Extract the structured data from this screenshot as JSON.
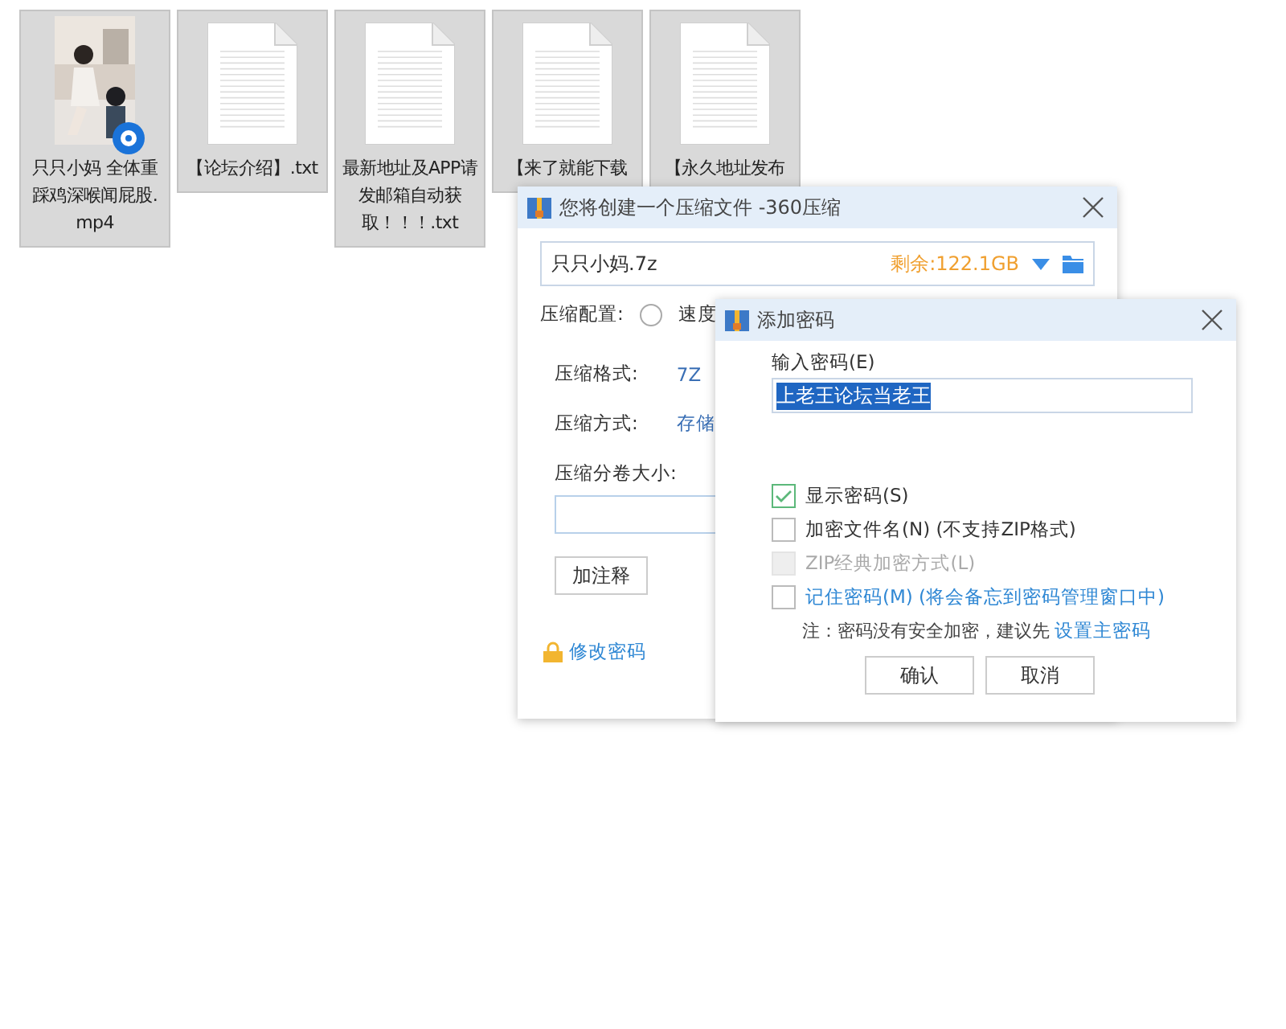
{
  "files": [
    {
      "name": "只只小妈 全体重踩鸡深喉闻屁股.mp4",
      "kind": "video"
    },
    {
      "name": "【论坛介绍】.txt",
      "kind": "text"
    },
    {
      "name": "最新地址及APP请发邮箱自动获取！！！.txt",
      "kind": "text"
    },
    {
      "name": "【来了就能下载",
      "kind": "text"
    },
    {
      "name": "【永久地址发布",
      "kind": "text"
    }
  ],
  "compress_dialog": {
    "title": "您将创建一个压缩文件 -360压缩",
    "filename": "只只小妈.7z",
    "free_space": "剩余:122.1GB",
    "config_label": "压缩配置:",
    "config_option": {
      "label": "速度",
      "selected": false
    },
    "format_label": "压缩格式:",
    "format_value": "7Z",
    "method_label": "压缩方式:",
    "method_value": "存储",
    "volume_label": "压缩分卷大小:",
    "comment_button": "加注释",
    "change_password_link": "修改密码"
  },
  "password_dialog": {
    "title": "添加密码",
    "password_label": "输入密码(E)",
    "password_value": "上老王论坛当老王",
    "options": [
      {
        "label": "显示密码(S)",
        "checked": true,
        "disabled": false,
        "kind": "plain"
      },
      {
        "label": "加密文件名(N) (不支持ZIP格式)",
        "checked": false,
        "disabled": false,
        "kind": "plain"
      },
      {
        "label": "ZIP经典加密方式(L)",
        "checked": false,
        "disabled": true,
        "kind": "plain"
      },
      {
        "label": "记住密码(M) (将会备忘到密码管理窗口中)",
        "checked": false,
        "disabled": false,
        "kind": "link"
      }
    ],
    "note": "注：密码没有安全加密，建议先",
    "note_link": "设置主密码",
    "buttons": [
      "确认",
      "取消"
    ]
  }
}
